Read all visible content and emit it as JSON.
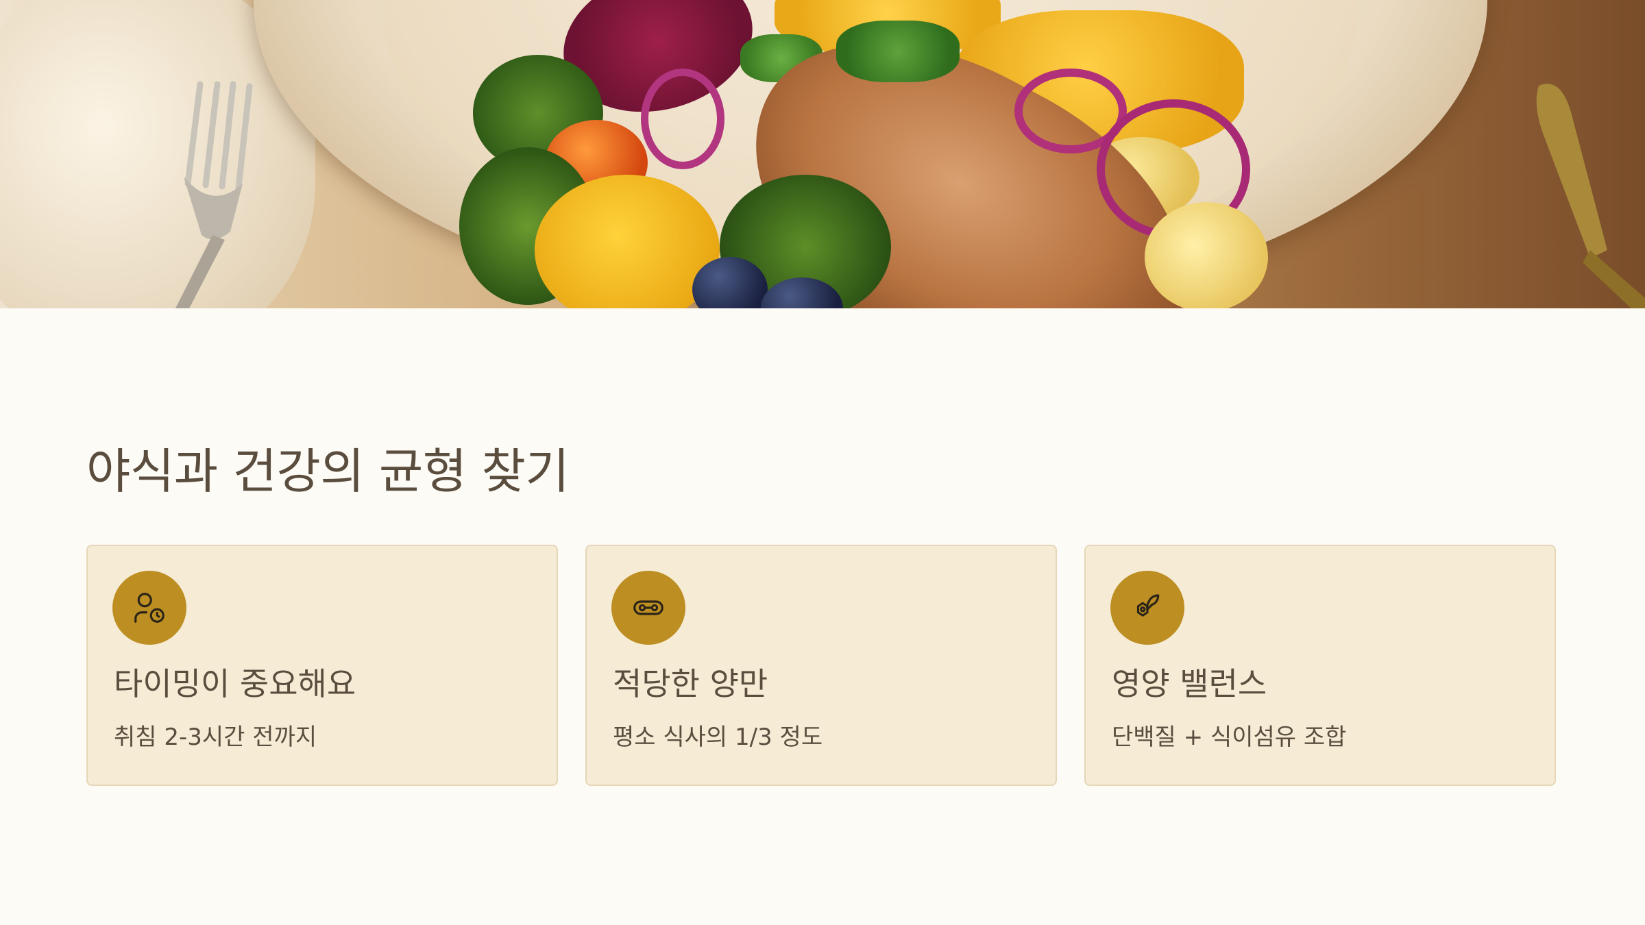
{
  "hero": {
    "image": "meal-photo",
    "icons": [
      "fork-icon",
      "knife-icon"
    ]
  },
  "title": "야식과 건강의 균형 찾기",
  "accent_color": "#bd8e22",
  "card_background": "#f6ecd6",
  "cards": [
    {
      "icon": "person-clock-icon",
      "title": "타이밍이 중요해요",
      "desc": "취침 2-3시간 전까지"
    },
    {
      "icon": "portion-icon",
      "title": "적당한 양만",
      "desc": "평소 식사의 1/3 정도"
    },
    {
      "icon": "nutrition-balance-icon",
      "title": "영양 밸런스",
      "desc": "단백질 + 식이섬유 조합"
    }
  ]
}
